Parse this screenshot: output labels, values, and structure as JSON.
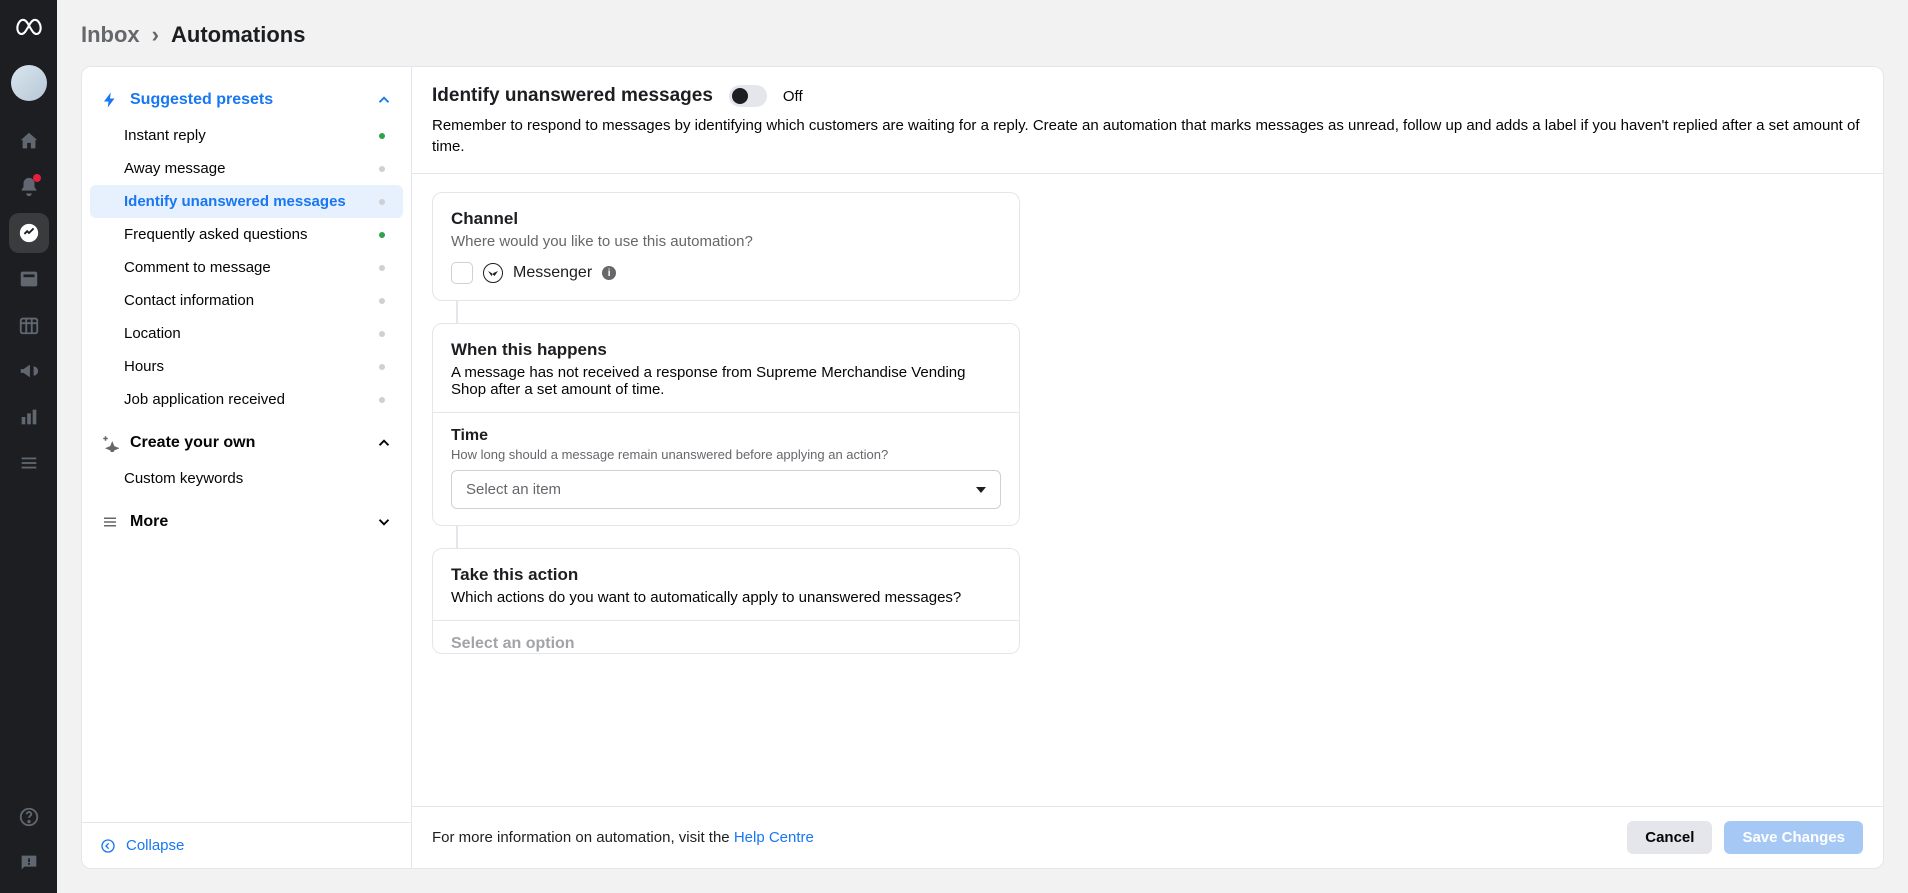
{
  "breadcrumb": {
    "inbox": "Inbox",
    "automations": "Automations"
  },
  "rail": {
    "icons": [
      "home",
      "bell",
      "chat",
      "card",
      "calendar",
      "megaphone",
      "chart",
      "menu"
    ],
    "bottom": [
      "help",
      "feedback"
    ]
  },
  "sidebar": {
    "suggested_label": "Suggested presets",
    "create_label": "Create your own",
    "more_label": "More",
    "collapse_label": "Collapse",
    "items": [
      {
        "label": "Instant reply",
        "status": "active"
      },
      {
        "label": "Away message",
        "status": "inactive"
      },
      {
        "label": "Identify unanswered messages",
        "status": "inactive"
      },
      {
        "label": "Frequently asked questions",
        "status": "active"
      },
      {
        "label": "Comment to message",
        "status": "inactive"
      },
      {
        "label": "Contact information",
        "status": "inactive"
      },
      {
        "label": "Location",
        "status": "inactive"
      },
      {
        "label": "Hours",
        "status": "inactive"
      },
      {
        "label": "Job application received",
        "status": "inactive"
      }
    ],
    "custom_items": [
      {
        "label": "Custom keywords"
      }
    ]
  },
  "detail": {
    "title": "Identify unanswered messages",
    "toggle_state": "Off",
    "description": "Remember to respond to messages by identifying which customers are waiting for a reply. Create an automation that marks messages as unread, follow up and adds a label if you haven't replied after a set amount of time.",
    "channel": {
      "heading": "Channel",
      "sub": "Where would you like to use this automation?",
      "messenger": "Messenger"
    },
    "when": {
      "heading": "When this happens",
      "sub": "A message has not received a response from Supreme Merchandise Vending Shop after a set amount of time.",
      "time_heading": "Time",
      "time_hint": "How long should a message remain unanswered before applying an action?",
      "select_placeholder": "Select an item"
    },
    "action": {
      "heading": "Take this action",
      "sub": "Which actions do you want to automatically apply to unanswered messages?",
      "option_heading": "Select an option"
    },
    "footer": {
      "info_prefix": "For more information on automation, visit the ",
      "help_link": "Help Centre",
      "cancel": "Cancel",
      "save": "Save Changes"
    }
  }
}
